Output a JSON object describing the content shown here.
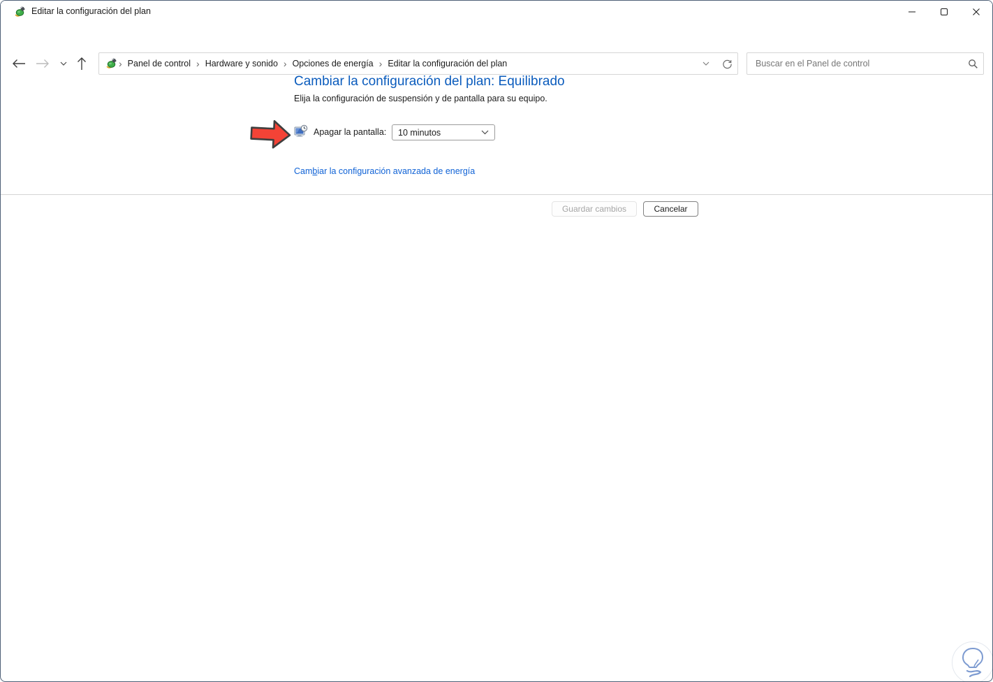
{
  "colors": {
    "heading_blue": "#0b5cbd",
    "link_blue": "#0f62d6",
    "arrow_red": "#f44336",
    "window_border": "#4e6077",
    "divider_gray": "#d4d4d4"
  },
  "icons": {
    "app": "power-plan-icon",
    "back": "arrow-left-icon",
    "forward": "arrow-right-icon",
    "recent": "chevron-down-icon",
    "up": "arrow-up-icon",
    "address_dropdown": "chevron-down-icon",
    "refresh": "refresh-icon",
    "search": "magnifier-icon",
    "setting": "display-clock-icon",
    "watermark": "lightbulb-icon",
    "minimize": "minimize-icon",
    "maximize": "maximize-icon",
    "close": "close-icon"
  },
  "titlebar": {
    "title": "Editar la configuración del plan"
  },
  "navbar": {
    "breadcrumb": {
      "items": [
        "Panel de control",
        "Hardware y sonido",
        "Opciones de energía",
        "Editar la configuración del plan"
      ],
      "separator": "›"
    },
    "search": {
      "placeholder": "Buscar en el Panel de control"
    }
  },
  "main": {
    "heading": "Cambiar la configuración del plan: Equilibrado",
    "subtitle": "Elija la configuración de suspensión y de pantalla para su equipo.",
    "display_setting": {
      "label": "Apagar la pantalla:",
      "value": "10 minutos"
    },
    "advanced_link": {
      "pre": "Cam",
      "underlined": "b",
      "post": "iar la configuración avanzada de energía"
    }
  },
  "footer": {
    "save_label": "Guardar cambios",
    "cancel_label": "Cancelar"
  }
}
